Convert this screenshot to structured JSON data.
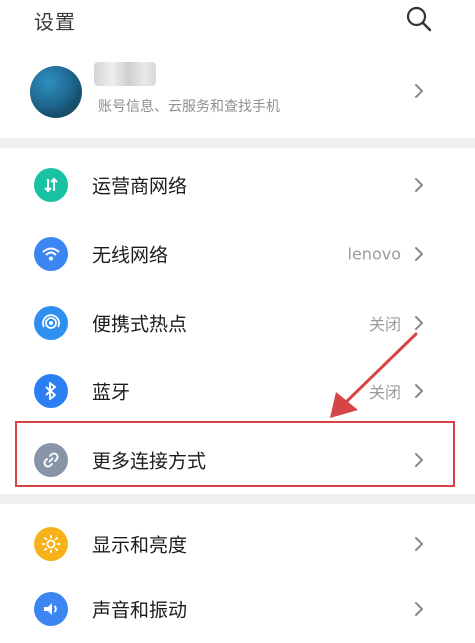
{
  "header": {
    "title": "设置",
    "search_icon": "search-icon"
  },
  "account": {
    "name_hidden": true,
    "subtitle": "账号信息、云服务和查找手机",
    "chevron_icon": "chevron-right-icon"
  },
  "settings": [
    {
      "label": "运营商网络",
      "value": "",
      "icon": "carrier-network-icon",
      "color": "#19c2a0"
    },
    {
      "label": "无线网络",
      "value": "lenovo",
      "icon": "wifi-icon",
      "color": "#3b86f2"
    },
    {
      "label": "便携式热点",
      "value": "关闭",
      "icon": "hotspot-icon",
      "color": "#2f8ff0"
    },
    {
      "label": "蓝牙",
      "value": "关闭",
      "icon": "bluetooth-icon",
      "color": "#2c7ff2"
    },
    {
      "label": "更多连接方式",
      "value": "",
      "icon": "link-icon",
      "color": "#8895a8"
    },
    {
      "label": "显示和亮度",
      "value": "",
      "icon": "brightness-icon",
      "color": "#f7b21a"
    },
    {
      "label": "声音和振动",
      "value": "",
      "icon": "sound-icon",
      "color": "#3b86f2"
    }
  ],
  "annotation": {
    "highlight_color": "#d64545"
  }
}
